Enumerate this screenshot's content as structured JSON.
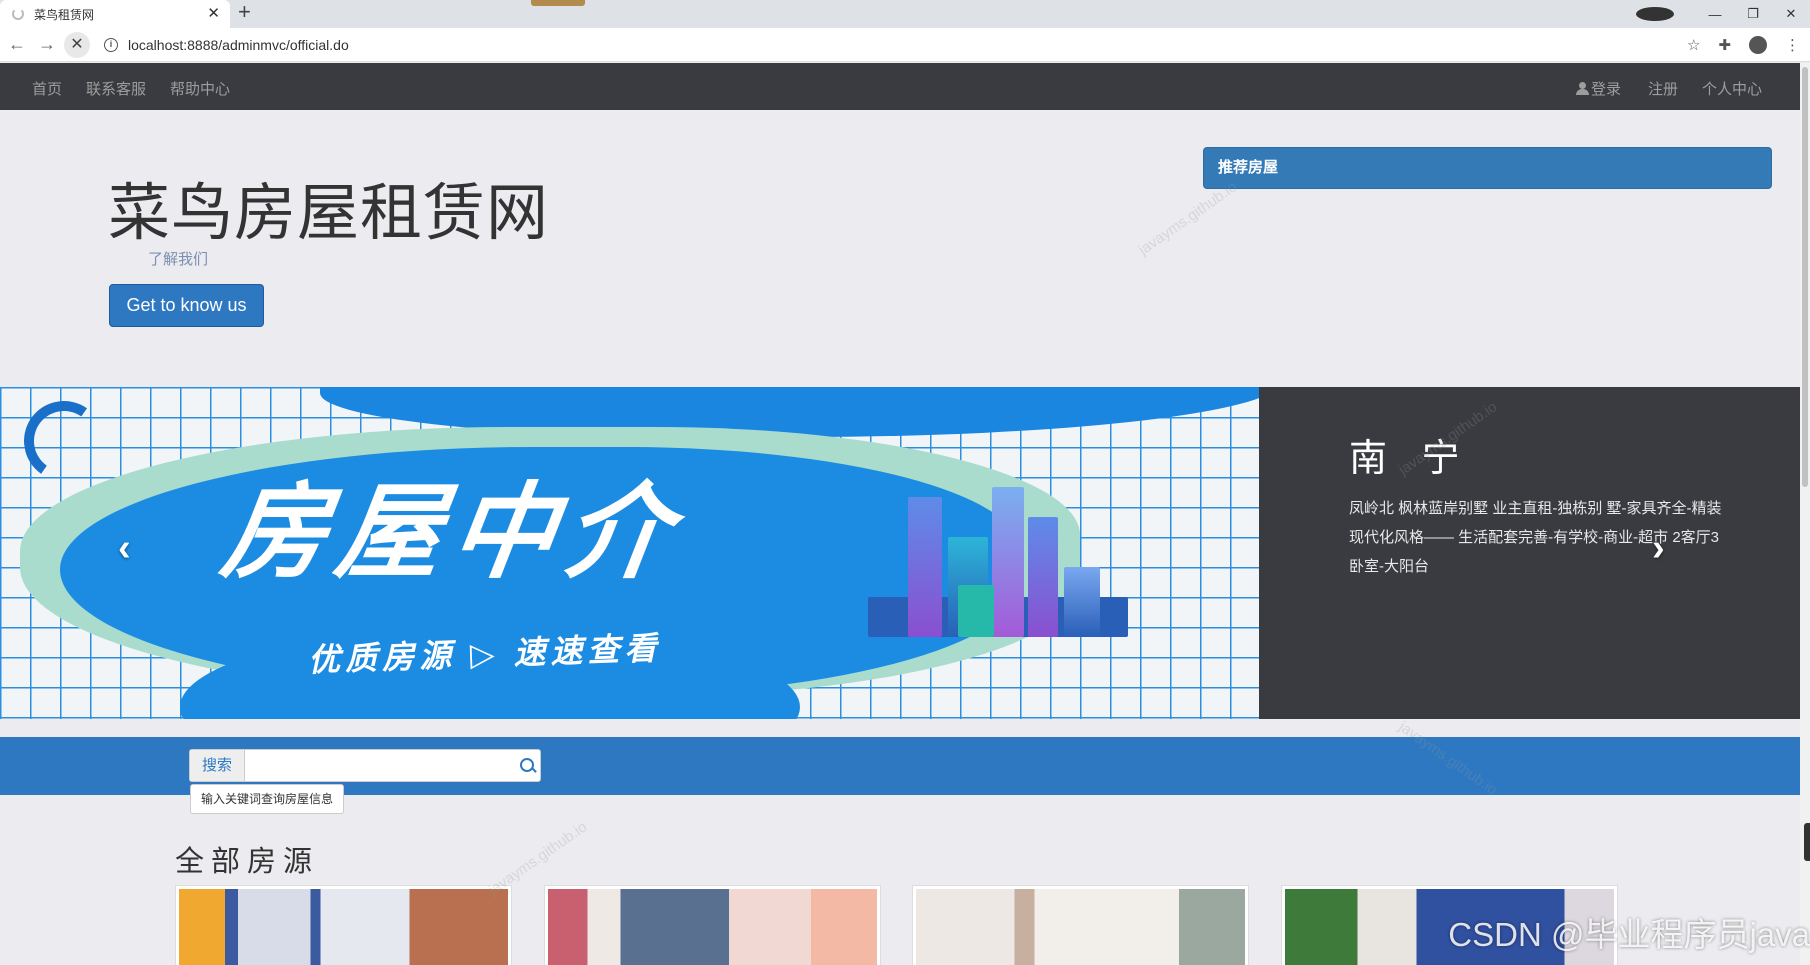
{
  "browser": {
    "tab_title": "菜鸟租赁网",
    "tab_close": "✕",
    "new_tab": "+",
    "url": "localhost:8888/adminmvc/official.do",
    "icons": [
      "back-arrow-icon",
      "forward-arrow-icon",
      "stop-loading-icon",
      "info-icon",
      "star-icon",
      "extension-icon",
      "profile-icon",
      "kebab-menu-icon"
    ]
  },
  "nav": {
    "left": [
      "首页",
      "联系客服",
      "帮助中心"
    ],
    "login": "登录",
    "register": "注册",
    "personal": "个人中心"
  },
  "hero": {
    "title": "菜鸟房屋租赁网",
    "subtitle": "了解我们",
    "button": "Get to know us"
  },
  "recommend": {
    "title": "推荐房屋"
  },
  "carousel": {
    "slide_heading": "房屋中介",
    "slide_sub": "优质房源 ▷ 速速查看",
    "city": "南 宁",
    "description": "凤岭北 枫林蓝岸别墅 业主直租-独栋别 墅-家具齐全-精装现代化风格—— 生活配套完善-有学校-商业-超市 2客厅3卧室-大阳台",
    "prev": "‹",
    "next": "›"
  },
  "search": {
    "label": "搜索",
    "value": "",
    "tooltip": "输入关键词查询房屋信息"
  },
  "listing": {
    "title": "全部房源"
  },
  "watermark": "javayms.github.io",
  "csdn_mark": "CSDN @毕业程序员java",
  "colors": {
    "nav_bg": "#3a3b41",
    "primary": "#337ab7",
    "band": "#2e78c2",
    "page_bg": "#ececf0"
  }
}
